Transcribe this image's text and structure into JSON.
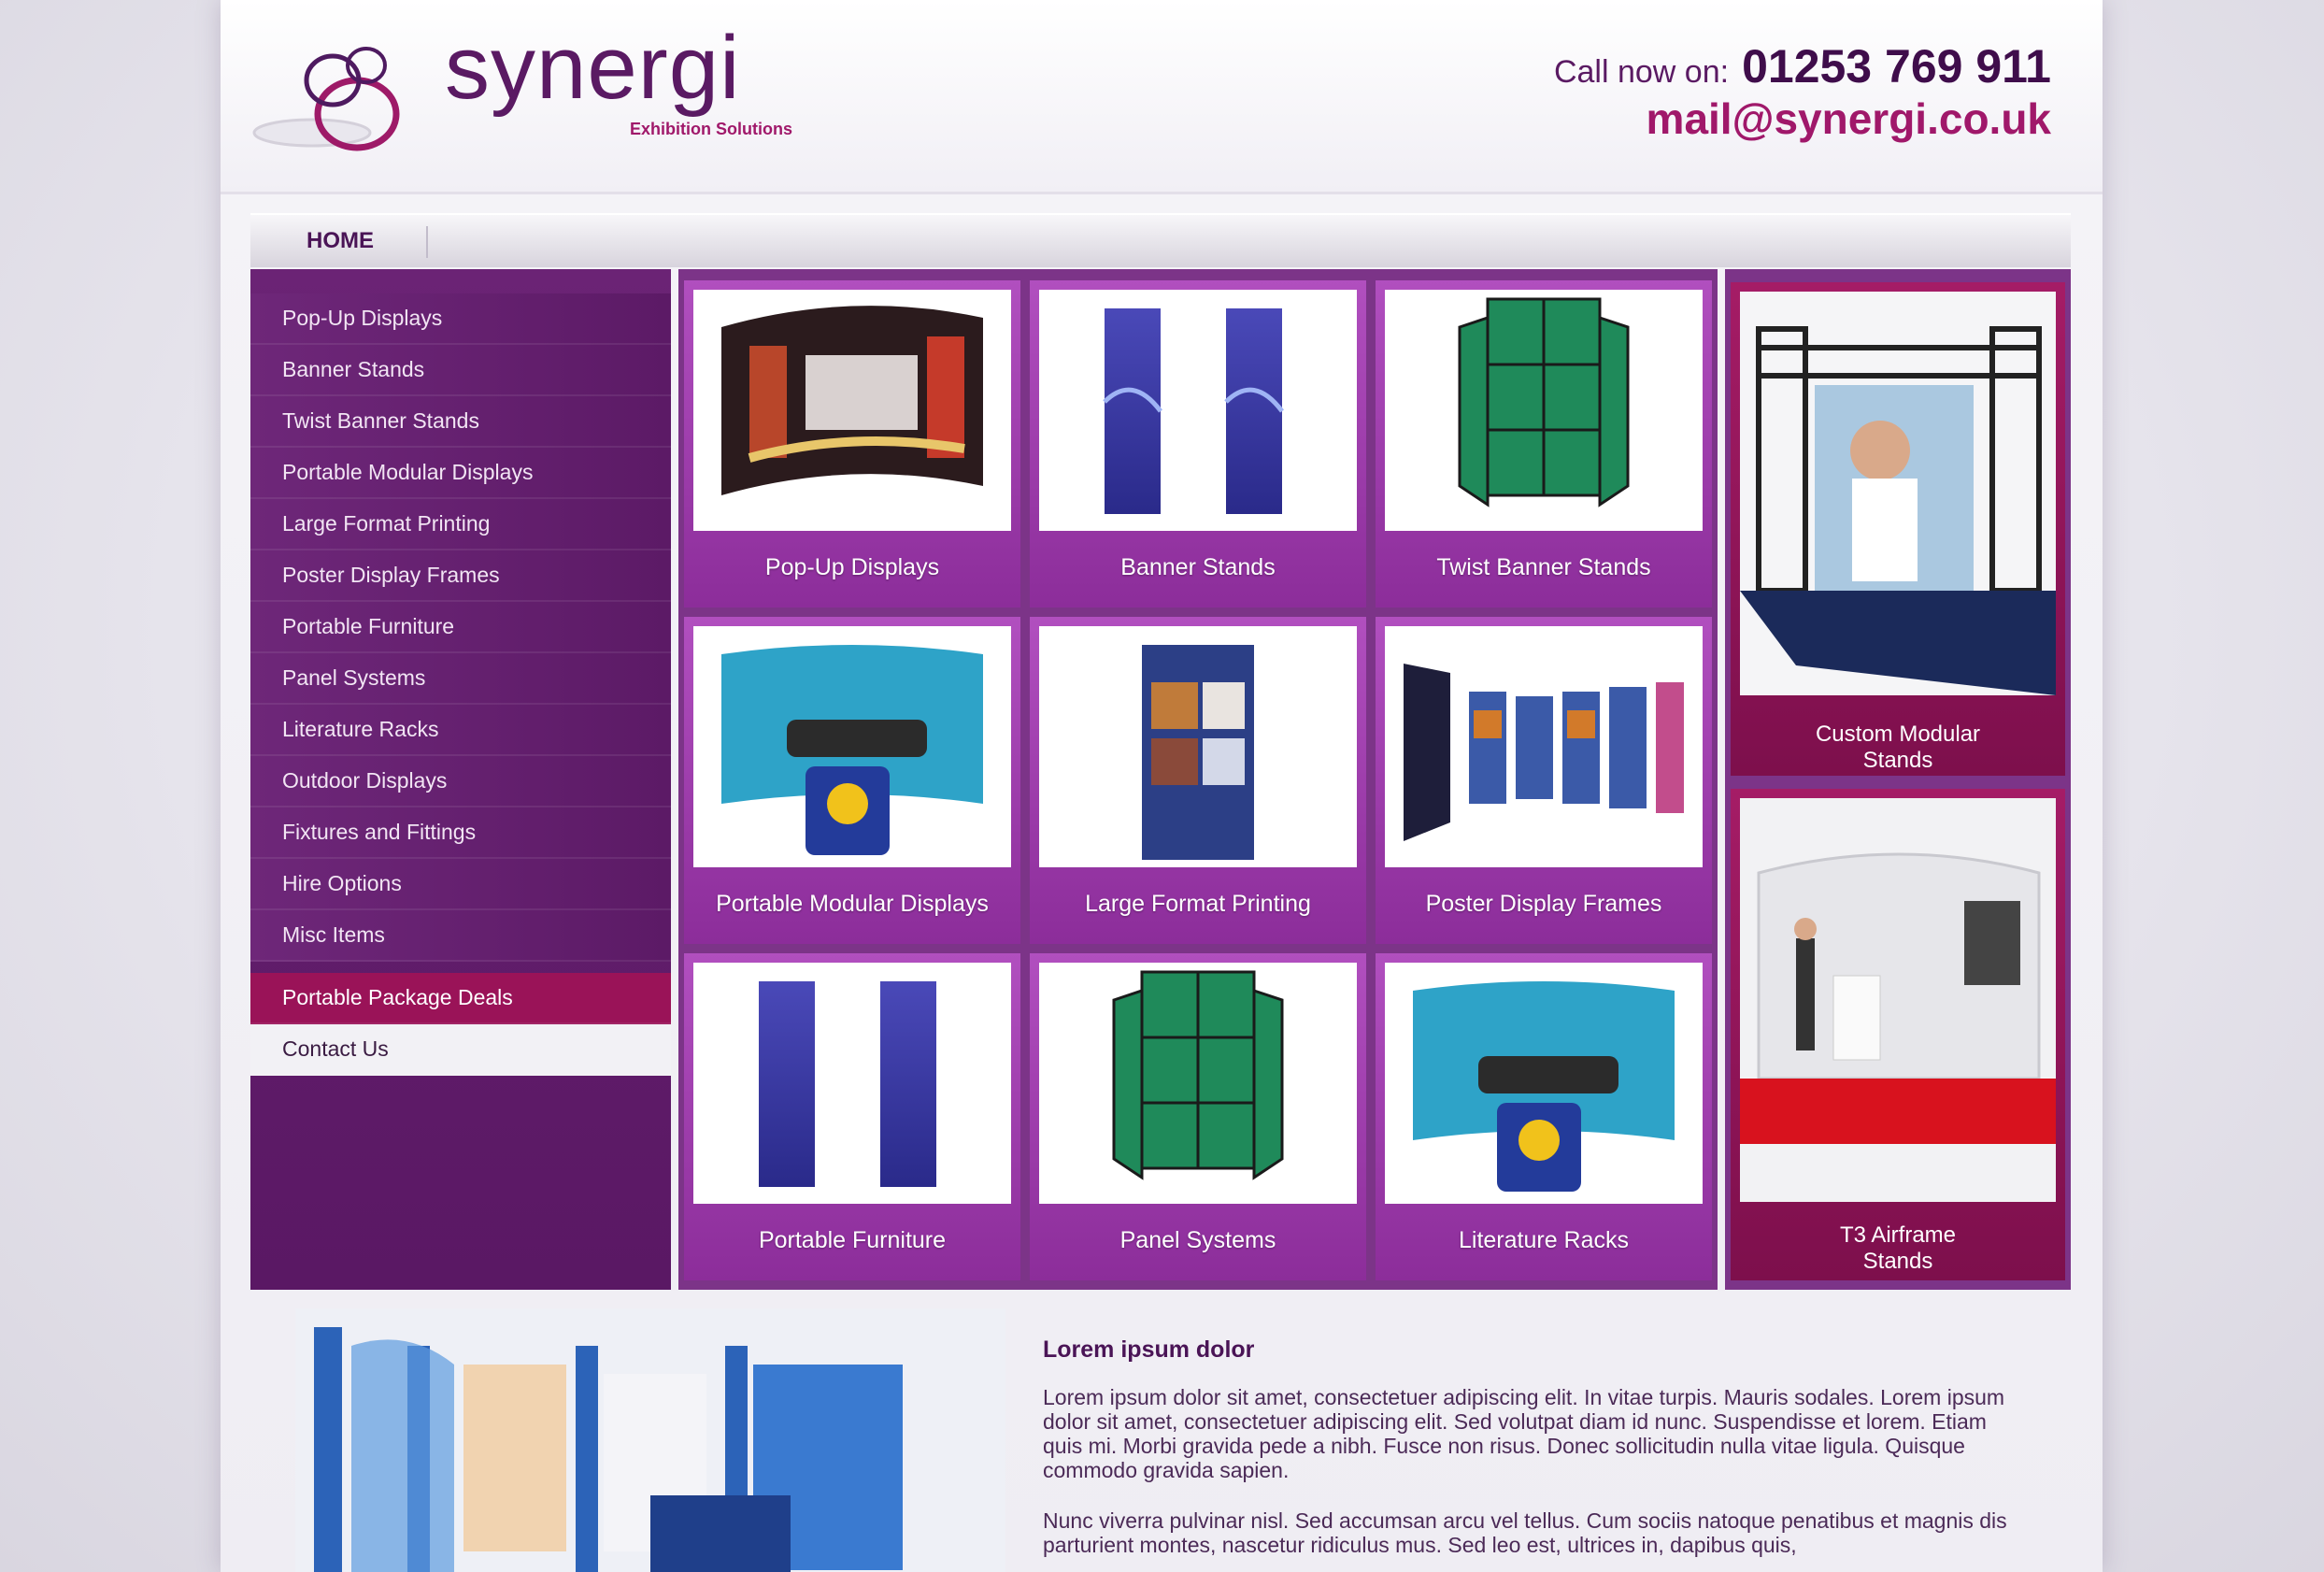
{
  "header": {
    "logo_text": "synergi",
    "logo_subtitle": "Exhibition Solutions",
    "call_label": "Call now on:",
    "phone": "01253 769 911",
    "email": "mail@synergi.co.uk"
  },
  "nav": {
    "home": "HOME"
  },
  "sidebar": {
    "items": [
      {
        "label": "Pop-Up Displays"
      },
      {
        "label": "Banner Stands"
      },
      {
        "label": "Twist Banner Stands"
      },
      {
        "label": "Portable Modular Displays"
      },
      {
        "label": "Large Format Printing"
      },
      {
        "label": "Poster Display Frames"
      },
      {
        "label": "Portable Furniture"
      },
      {
        "label": "Panel Systems"
      },
      {
        "label": "Literature Racks"
      },
      {
        "label": "Outdoor Displays"
      },
      {
        "label": "Fixtures and Fittings"
      },
      {
        "label": "Hire Options"
      },
      {
        "label": "Misc Items"
      },
      {
        "label": "Portable Package Deals"
      },
      {
        "label": "Contact Us"
      }
    ]
  },
  "grid": {
    "tiles": [
      {
        "label": "Pop-Up Displays"
      },
      {
        "label": "Banner Stands"
      },
      {
        "label": "Twist Banner Stands"
      },
      {
        "label": "Portable Modular Displays"
      },
      {
        "label": "Large Format Printing"
      },
      {
        "label": "Poster Display Frames"
      },
      {
        "label": "Portable Furniture"
      },
      {
        "label": "Panel Systems"
      },
      {
        "label": "Literature Racks"
      }
    ]
  },
  "right": {
    "tiles": [
      {
        "label_line1": "Custom Modular",
        "label_line2": "Stands"
      },
      {
        "label_line1": "T3 Airframe",
        "label_line2": "Stands"
      }
    ]
  },
  "content": {
    "title": "Lorem ipsum dolor",
    "p1": "Lorem ipsum dolor sit amet, consectetuer adipiscing elit. In vitae turpis. Mauris sodales. Lorem ipsum dolor sit amet, consectetuer adipiscing elit. Sed volutpat diam id nunc. Suspendisse et lorem. Etiam quis mi. Morbi gravida pede a nibh. Fusce non risus. Donec sollicitudin nulla vitae ligula. Quisque commodo gravida sapien.",
    "p2": "Nunc viverra pulvinar nisl. Sed accumsan arcu vel tellus. Cum sociis natoque penatibus et magnis dis parturient montes, nascetur ridiculus mus. Sed leo est, ultrices in, dapibus quis,"
  },
  "colors": {
    "brand_purple": "#5a1a63",
    "brand_magenta": "#a0186a",
    "sidebar_active": "#9a1358",
    "tile_purple": "#9b3fab"
  }
}
